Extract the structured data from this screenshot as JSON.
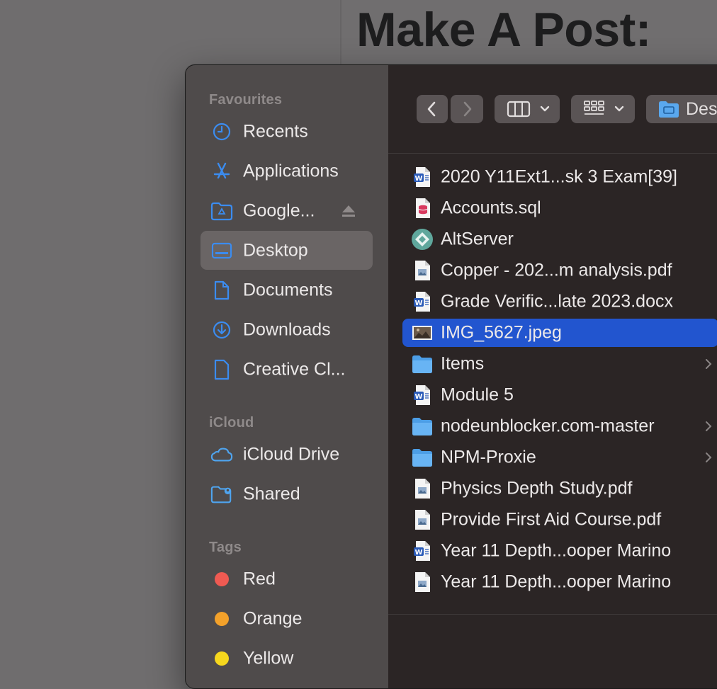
{
  "background": {
    "heading": "Make A Post:"
  },
  "sidebar": {
    "sections": {
      "favourites": "Favourites",
      "icloud": "iCloud",
      "tags": "Tags"
    },
    "favourites": [
      {
        "label": "Recents",
        "icon": "clock-icon"
      },
      {
        "label": "Applications",
        "icon": "applications-icon"
      },
      {
        "label": "Google...",
        "icon": "google-drive-folder-icon"
      },
      {
        "label": "Desktop",
        "icon": "desktop-icon"
      },
      {
        "label": "Documents",
        "icon": "document-icon"
      },
      {
        "label": "Downloads",
        "icon": "download-icon"
      },
      {
        "label": "Creative Cl...",
        "icon": "file-icon"
      }
    ],
    "icloud": [
      {
        "label": "iCloud Drive",
        "icon": "cloud-icon"
      },
      {
        "label": "Shared",
        "icon": "shared-folder-icon"
      }
    ],
    "tags": [
      {
        "label": "Red",
        "color": "#ef5a52"
      },
      {
        "label": "Orange",
        "color": "#f3a12a"
      },
      {
        "label": "Yellow",
        "color": "#f6d71d"
      }
    ]
  },
  "toolbar": {
    "location": "Des"
  },
  "files": [
    {
      "name": "2020 Y11Ext1...sk 3 Exam[39]",
      "type": "word"
    },
    {
      "name": "Accounts.sql",
      "type": "sql"
    },
    {
      "name": "AltServer",
      "type": "app"
    },
    {
      "name": "Copper - 202...m analysis.pdf",
      "type": "pdf"
    },
    {
      "name": "Grade Verific...late 2023.docx",
      "type": "word"
    },
    {
      "name": "IMG_5627.jpeg",
      "type": "image"
    },
    {
      "name": "Items",
      "type": "folder"
    },
    {
      "name": "Module 5",
      "type": "word"
    },
    {
      "name": "nodeunblocker.com-master",
      "type": "folder"
    },
    {
      "name": "NPM-Proxie",
      "type": "folder"
    },
    {
      "name": "Physics Depth Study.pdf",
      "type": "pdf"
    },
    {
      "name": "Provide First Aid Course.pdf",
      "type": "pdf"
    },
    {
      "name": "Year 11 Depth...ooper Marino",
      "type": "word"
    },
    {
      "name": "Year 11 Depth...ooper Marino",
      "type": "pdf"
    }
  ],
  "colors": {
    "accent": "#2255cf",
    "sidebar_icon": "#3b8cf0"
  }
}
